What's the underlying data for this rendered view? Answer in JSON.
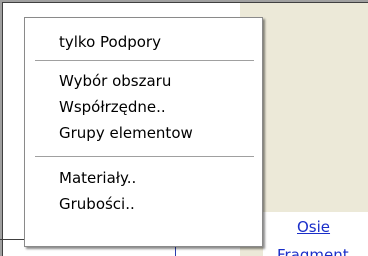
{
  "background": {
    "links": {
      "osie": "Osie",
      "fragment": "Fragment"
    }
  },
  "context_menu": {
    "groups": [
      [
        "tylko Podpory"
      ],
      [
        "Wybór obszaru",
        "Współrzędne..",
        "Grupy elementow"
      ],
      [
        "Materiały..",
        "Grubości.."
      ]
    ]
  },
  "colors": {
    "panel_bg": "#ece9d8",
    "link": "#1a2ec9",
    "menu_bg": "#ffffff"
  }
}
